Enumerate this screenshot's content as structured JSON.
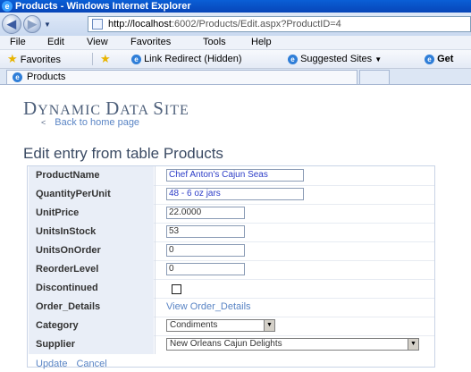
{
  "window": {
    "title": "Products - Windows Internet Explorer"
  },
  "address": {
    "url_host": "http://localhost",
    "url_rest": ":6002/Products/Edit.aspx?ProductID=4"
  },
  "menu": [
    "File",
    "Edit",
    "View",
    "Favorites",
    "Tools",
    "Help"
  ],
  "favorites": {
    "favorites_label": "Favorites",
    "link1": "Link Redirect (Hidden)",
    "link2": "Suggested Sites",
    "link3": "Get"
  },
  "tab": {
    "label": "Products"
  },
  "page": {
    "site_title_big": "D",
    "site_title_rest": "YNAMIC ",
    "site_title_big2": "D",
    "site_title_rest2": "ATA ",
    "site_title_big3": "S",
    "site_title_rest3": "ITE",
    "back_link": "Back to home page",
    "back_arrow": "<",
    "heading": "Edit entry from table Products"
  },
  "form": {
    "fields": [
      {
        "label": "ProductName",
        "value": "Chef Anton's Cajun Seas"
      },
      {
        "label": "QuantityPerUnit",
        "value": "48 - 6 oz jars"
      },
      {
        "label": "UnitPrice",
        "value": "22.0000"
      },
      {
        "label": "UnitsInStock",
        "value": "53"
      },
      {
        "label": "UnitsOnOrder",
        "value": "0"
      },
      {
        "label": "ReorderLevel",
        "value": "0"
      },
      {
        "label": "Discontinued",
        "checked": false
      },
      {
        "label": "Order_Details",
        "link": "View Order_Details"
      },
      {
        "label": "Category",
        "selected": "Condiments"
      },
      {
        "label": "Supplier",
        "selected": "New Orleans Cajun Delights"
      }
    ],
    "update_label": "Update",
    "cancel_label": "Cancel"
  }
}
